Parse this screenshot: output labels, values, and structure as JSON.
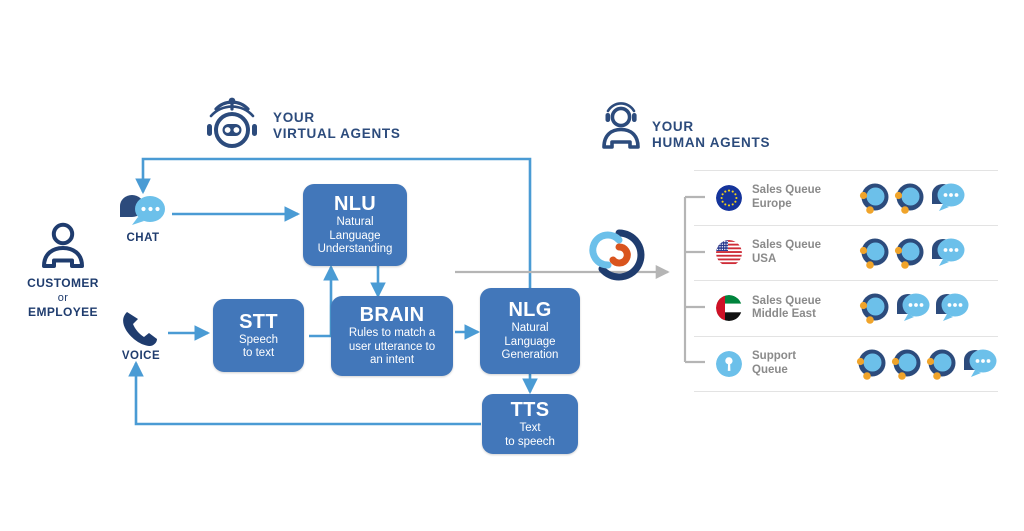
{
  "diagram": {
    "title_virtual": {
      "line1": "YOUR",
      "line2": "VIRTUAL AGENTS"
    },
    "title_human": {
      "line1": "YOUR",
      "line2": "HUMAN AGENTS"
    },
    "actor": {
      "line1": "CUSTOMER",
      "line2": "or",
      "line3": "EMPLOYEE"
    },
    "channels": [
      {
        "id": "chat",
        "label": "CHAT",
        "icon": "chat-bubbles-icon"
      },
      {
        "id": "voice",
        "label": "VOICE",
        "icon": "phone-handset-icon"
      }
    ],
    "boxes": [
      {
        "id": "nlu",
        "title": "NLU",
        "subtitle": "Natural\nLanguage\nUnderstanding"
      },
      {
        "id": "stt",
        "title": "STT",
        "subtitle": "Speech\nto text"
      },
      {
        "id": "brain",
        "title": "BRAIN",
        "subtitle": "Rules to match a\nuser utterance to\nan intent"
      },
      {
        "id": "nlg",
        "title": "NLG",
        "subtitle": "Natural\nLanguage\nGeneration"
      },
      {
        "id": "tts",
        "title": "TTS",
        "subtitle": "Text\nto speech"
      }
    ],
    "router": {
      "icon": "routing-swirl-icon"
    },
    "queues": [
      {
        "id": "sales-europe",
        "line1": "Sales Queue",
        "line2": "Europe",
        "flag": "eu-flag-icon",
        "agents": 2,
        "bubbles": 1
      },
      {
        "id": "sales-usa",
        "line1": "Sales Queue",
        "line2": "USA",
        "flag": "usa-flag-icon",
        "agents": 2,
        "bubbles": 1
      },
      {
        "id": "sales-middle-east",
        "line1": "Sales Queue",
        "line2": "Middle East",
        "flag": "uae-flag-icon",
        "agents": 1,
        "bubbles": 2
      },
      {
        "id": "support",
        "line1": "Support",
        "line2": "Queue",
        "flag": "support-tool-icon",
        "agents": 3,
        "bubbles": 1
      }
    ]
  },
  "colors": {
    "navy": "#2C4B7C",
    "box_blue": "#4277BA",
    "arrow_blue": "#4A9BD4",
    "light_blue": "#6CC0EA",
    "gray_line": "#b5b5b5",
    "label_gray": "#8a8a8a",
    "accent_orange": "#D9541E",
    "avatar_dot": "#F0A42A",
    "background": "#FFFFFF"
  }
}
